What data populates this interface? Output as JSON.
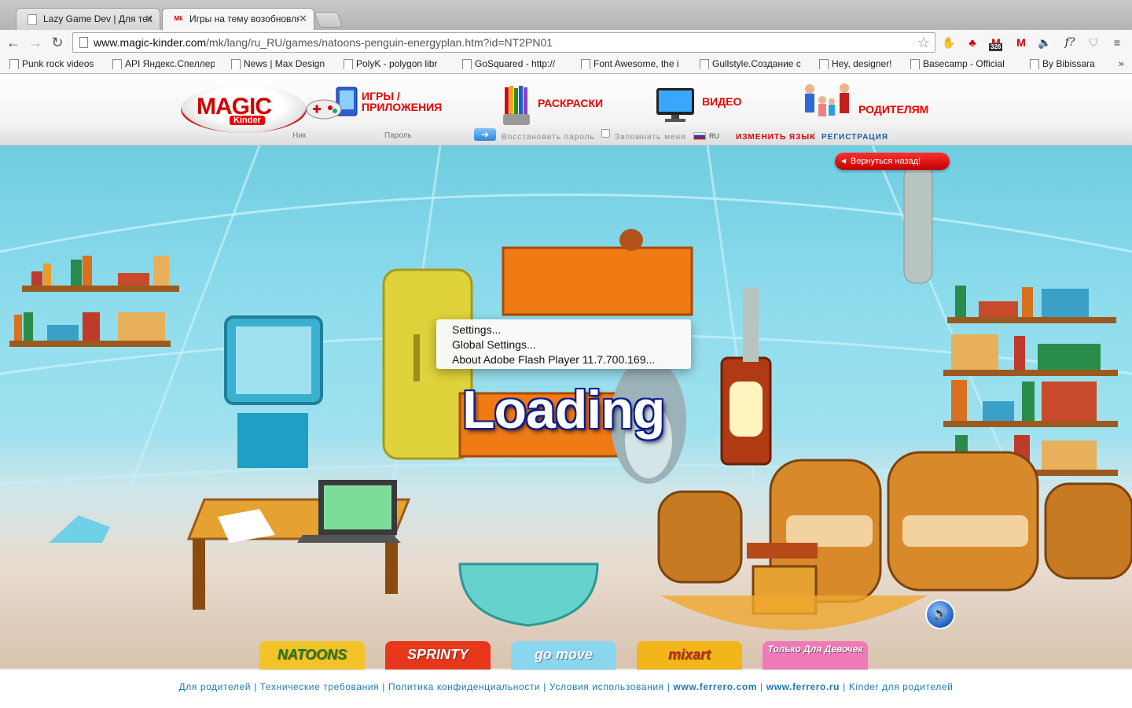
{
  "browser": {
    "tabs": [
      {
        "title": "Lazy Game Dev | Для тех, ",
        "active": false
      },
      {
        "title": "Игры на тему возобновля",
        "active": true,
        "favicon": "Mk"
      }
    ],
    "url": {
      "host": "www.magic-kinder.com",
      "path": "/mk/lang/ru_RU/games/natoons-penguin-energyplan.htm?id=NT2PN01"
    },
    "extensions": [
      "adblock-icon",
      "ext-icon",
      "gmail-icon",
      "gmail-icon",
      "speaker-icon",
      "fx-icon",
      "shield-icon"
    ],
    "gmail_badge": "326",
    "bookmarks": [
      "Punk rock videos",
      "API Яндекс.Спеллер",
      "News | Max Design",
      "PolyK - polygon libr",
      "GoSquared - http://",
      "Font Awesome, the i",
      "Gullstyle.Создание с",
      "Hey, designer!",
      "Basecamp - Official",
      "By Bibissara"
    ],
    "bookmarks_more": "»"
  },
  "site": {
    "logo": {
      "magic": "MAGIC",
      "kinder": "Kinder"
    },
    "menu": {
      "games": "ИГРЫ / ПРИЛОЖЕНИЯ",
      "coloring": "РАСКРАСКИ",
      "video": "ВИДЕО",
      "parents": "РОДИТЕЛЯМ"
    },
    "login": {
      "nick_placeholder": "Ник",
      "password_placeholder": "Пароль",
      "restore": "Восстановить пароль",
      "remember": "Запомнить меня",
      "lang_code": "RU",
      "change_lang": "ИЗМЕНИТЬ ЯЗЫК",
      "register": "РЕГИСТРАЦИЯ"
    },
    "back_button": "Вернуться назад!"
  },
  "game": {
    "loading_text": "Loading",
    "context_menu": [
      "Settings...",
      "Global Settings...",
      "About Adobe Flash Player 11.7.700.169..."
    ],
    "brands": [
      "NATOONS",
      "SPRINTY",
      "go move",
      "mixart",
      "Только Для Девочек"
    ],
    "colors": {
      "sky": "#8edced",
      "floor": "#d9c3ae",
      "accent_red": "#e00000"
    }
  },
  "footer": {
    "links": [
      "Для родителей",
      "Технические требования",
      "Политика конфиденциальности",
      "Условия использования",
      "www.ferrero.com",
      "www.ferrero.ru",
      "Kinder для родителей"
    ]
  }
}
